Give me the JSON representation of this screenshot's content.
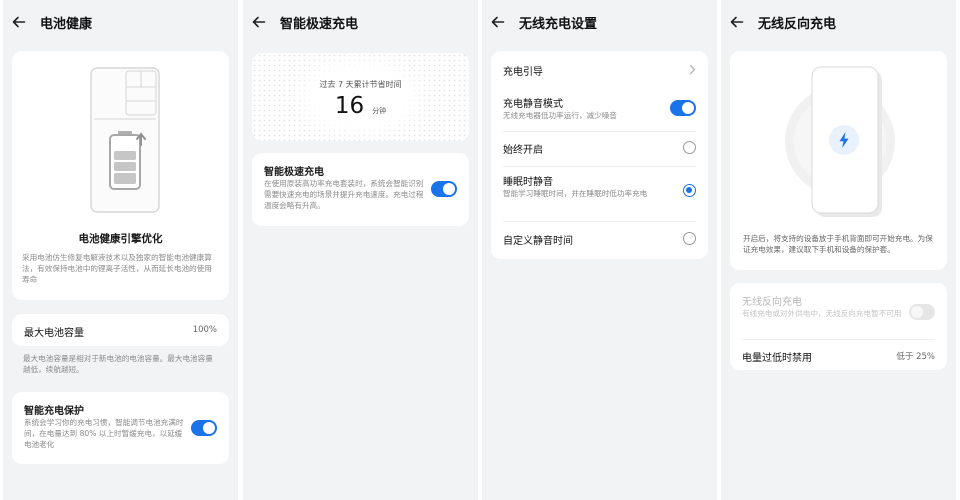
{
  "colors": {
    "accent": "#1a73e8",
    "background": "#f2f3f5",
    "card": "#ffffff",
    "muted": "#8a8a8a"
  },
  "icons": {
    "back": "arrow-left-icon",
    "battery": "battery-icon",
    "chevron": "chevron-right-icon",
    "lightning": "lightning-icon"
  },
  "screen1": {
    "title": "电池健康",
    "engine_title": "电池健康引擎优化",
    "engine_desc": "采用电池仿生修复电解液技术以及独家的智能电池健康算法，有效保持电池中的锂离子活性，从而延长电池的使用寿命",
    "capacity_label": "最大电池容量",
    "capacity_value": "100%",
    "capacity_note": "最大电池容量是相对于新电池的电池容量。最大电池容量越低，续航越短。",
    "protect_label": "智能充电保护",
    "protect_desc": "系统会学习你的充电习惯，智能调节电池充满时间，在电量达到 80% 以上时暂缓充电，以延缓电池老化",
    "protect_on": true
  },
  "screen2": {
    "title": "智能极速充电",
    "stat_label": "过去 7 天累计节省时间",
    "stat_value": "16",
    "stat_unit": "分钟",
    "fast_label": "智能极速充电",
    "fast_desc": "在使用原装高功率充电套装时，系统会智能识别需要快速充电的场景并提升充电速度。充电过程温度会略有升高。",
    "fast_on": true
  },
  "screen3": {
    "title": "无线充电设置",
    "guide_label": "充电引导",
    "silent_label": "充电静音模式",
    "silent_desc": "无线充电器低功率运行，减少噪音",
    "silent_on": true,
    "always_label": "始终开启",
    "sleep_label": "睡眠时静音",
    "sleep_desc": "智能学习睡眠时间，并在睡眠时低功率充电",
    "custom_label": "自定义静音时间",
    "selected_option": "睡眠时静音"
  },
  "screen4": {
    "title": "无线反向充电",
    "hint": "开启后，将支持的设备放于手机背面即可开始充电。为保证充电效果，建议取下手机和设备的保护套。",
    "reverse_label": "无线反向充电",
    "reverse_desc": "有线充电或对外供电中，无线反向充电暂不可用",
    "reverse_on": false,
    "low_battery_label": "电量过低时禁用",
    "low_battery_value": "低于 25%"
  }
}
